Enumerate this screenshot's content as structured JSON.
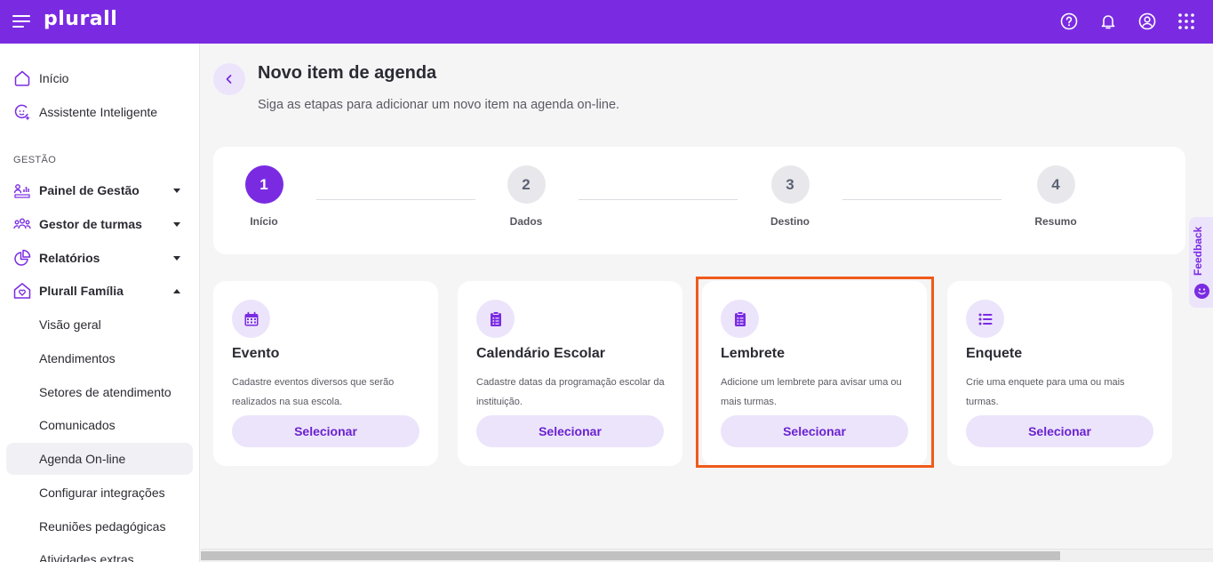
{
  "app": {
    "logo": "plurall",
    "colors": {
      "brand": "#7a2be2",
      "accent_light": "#ece4fb",
      "highlight": "#f05a1a"
    }
  },
  "topbar": {
    "icons": [
      "help-icon",
      "bell-icon",
      "user-icon",
      "apps-grid-icon"
    ]
  },
  "sidebar": {
    "items": [
      {
        "label": "Início",
        "icon": "home-icon"
      },
      {
        "label": "Assistente Inteligente",
        "icon": "assistant-icon"
      }
    ],
    "section_label": "GESTÃO",
    "gestao": [
      {
        "label": "Painel de Gestão",
        "icon": "dashboard-icon"
      },
      {
        "label": "Gestor de turmas",
        "icon": "people-icon"
      },
      {
        "label": "Relatórios",
        "icon": "pie-chart-icon"
      },
      {
        "label": "Plurall Família",
        "icon": "family-heart-icon"
      }
    ],
    "familia_sub": [
      {
        "label": "Visão geral"
      },
      {
        "label": "Atendimentos"
      },
      {
        "label": "Setores de atendimento"
      },
      {
        "label": "Comunicados"
      },
      {
        "label": "Agenda On-line",
        "active": true
      },
      {
        "label": "Configurar integrações"
      },
      {
        "label": "Reuniões pedagógicas"
      },
      {
        "label": "Atividades extras"
      }
    ]
  },
  "main": {
    "title": "Novo item de agenda",
    "subtitle": "Siga as etapas para adicionar um novo item na agenda on-line."
  },
  "stepper": {
    "current": 1,
    "steps": [
      {
        "num": "1",
        "label": "Início"
      },
      {
        "num": "2",
        "label": "Dados"
      },
      {
        "num": "3",
        "label": "Destino"
      },
      {
        "num": "4",
        "label": "Resumo"
      }
    ]
  },
  "cards": [
    {
      "title": "Evento",
      "desc": "Cadastre eventos diversos que serão realizados na sua escola.",
      "button": "Selecionar",
      "icon": "calendar-icon"
    },
    {
      "title": "Calendário Escolar",
      "desc": "Cadastre datas da programação escolar da instituição.",
      "button": "Selecionar",
      "icon": "clipboard-icon"
    },
    {
      "title": "Lembrete",
      "desc": "Adicione um lembrete para avisar uma ou mais turmas.",
      "button": "Selecionar",
      "icon": "clipboard-icon"
    },
    {
      "title": "Enquete",
      "desc": "Crie uma enquete para uma ou mais turmas.",
      "button": "Selecionar",
      "icon": "list-icon"
    }
  ],
  "feedback": {
    "label": "Feedback"
  }
}
